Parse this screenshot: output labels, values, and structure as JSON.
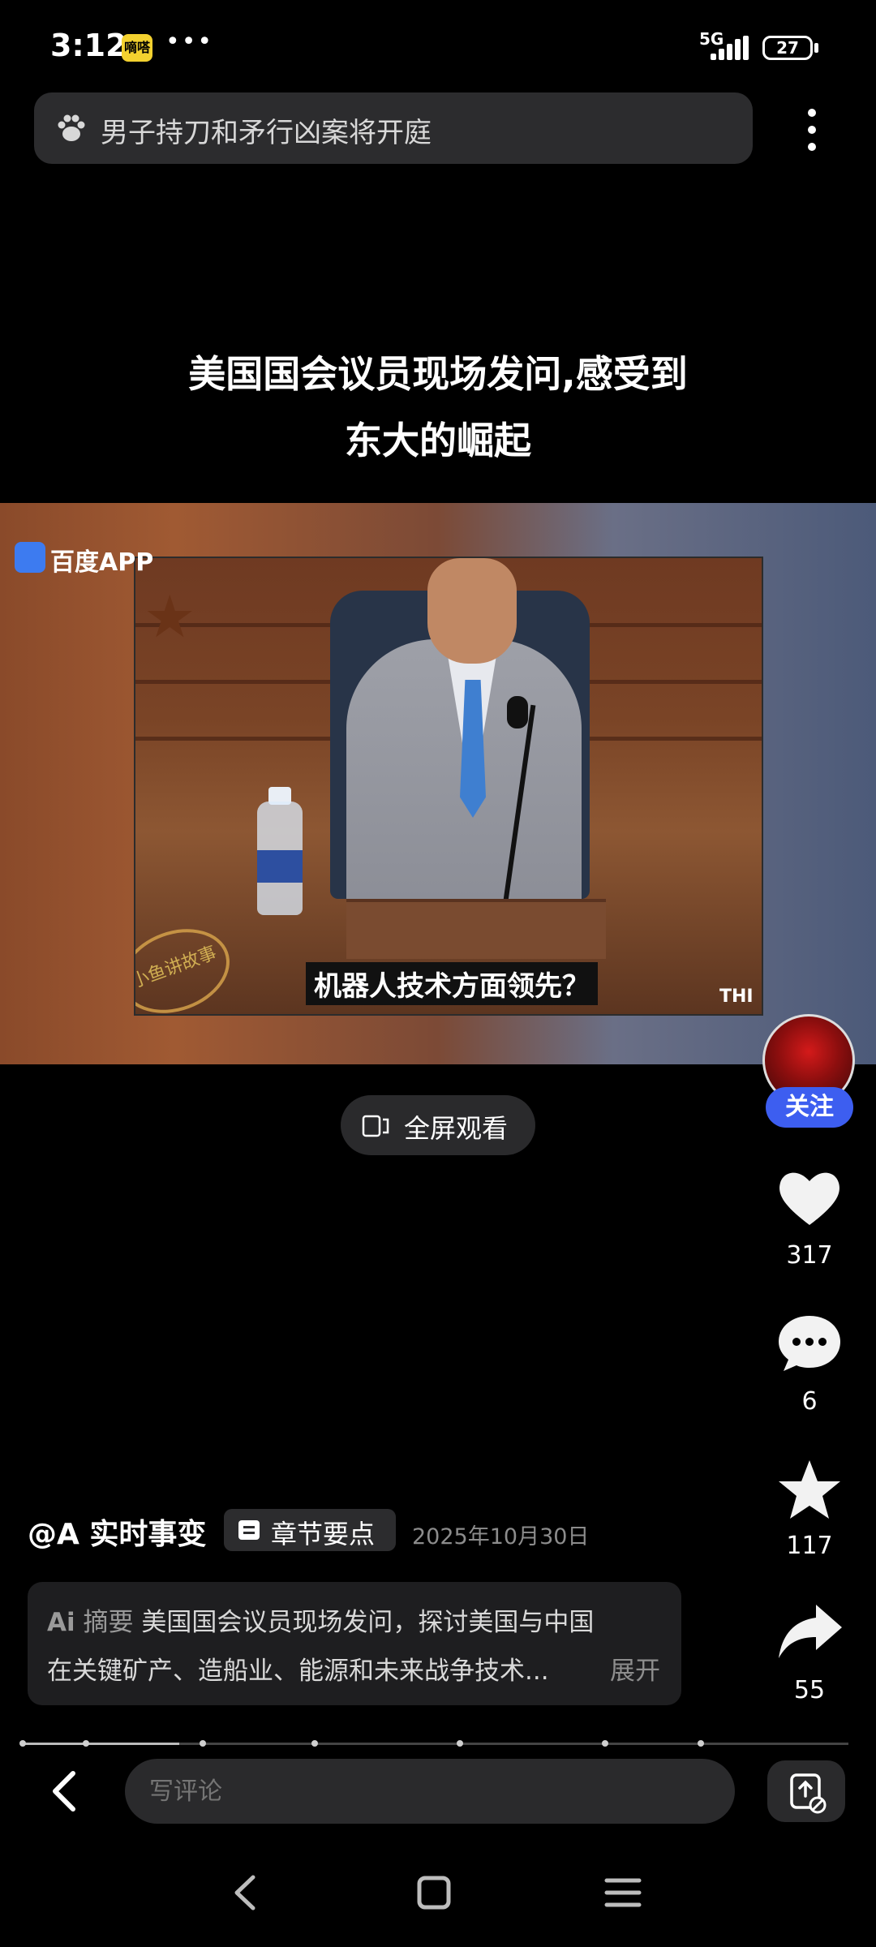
{
  "status_bar": {
    "time": "3:12",
    "badge": "嘀嗒",
    "more": "•••",
    "network": "5G",
    "battery": "27"
  },
  "search": {
    "query": "男子持刀和矛行凶案将开庭"
  },
  "video": {
    "title_line1": "美国国会议员现场发问,感受到",
    "title_line2": "东大的崛起",
    "watermark": "百度APP",
    "subtitle": "机器人技术方面领先？",
    "corner_text": "THI",
    "stamp_text": "小鱼讲故事"
  },
  "fullscreen": {
    "label": "全屏观看"
  },
  "rail": {
    "follow_label": "关注",
    "likes": "317",
    "comments": "6",
    "favorites": "117",
    "shares": "55"
  },
  "post": {
    "author": "@A 实时事变",
    "chapter_label": "章节要点",
    "date": "2025年10月30日",
    "summary_tag": "摘要",
    "summary_line1": "美国国会议员现场发问，探讨美国与中国",
    "summary_line2": "在关键矿产、造船业、能源和未来战争技术...",
    "expand_label": "展开"
  },
  "progress": {
    "fraction": 0.19
  },
  "comment": {
    "placeholder": "写评论"
  }
}
